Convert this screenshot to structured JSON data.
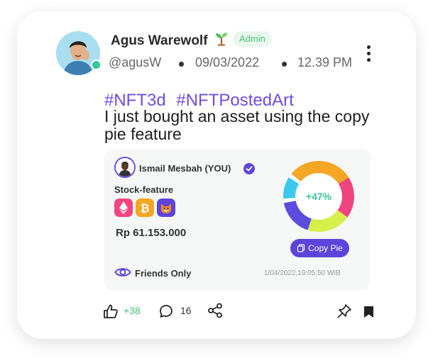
{
  "post": {
    "author": {
      "name": "Agus Warewolf",
      "role_badge": "Admin",
      "handle": "@agusW",
      "online": true
    },
    "date": "09/03/2022",
    "time": "12.39 PM",
    "hashtags": [
      "#NFT3d",
      "#NFTPostedArt"
    ],
    "text": "I just bought an asset using the copy pie feature",
    "shared_asset": {
      "owner_name": "Ismail Mesbah (YOU)",
      "section_label": "Stock-feature",
      "coins": [
        "ethereum-icon",
        "bitcoin-icon",
        "shiba-inu-icon"
      ],
      "price": "Rp 61.153.000",
      "visibility": "Friends Only",
      "timestamp": "1/04/2022,19:05:50 WIB",
      "pie_change": "+47%",
      "copy_button_label": "Copy Pie",
      "pie_segments": [
        {
          "color": "#f5a623",
          "fraction": 0.2
        },
        {
          "color": "#f0457f",
          "fraction": 0.19
        },
        {
          "color": "#d6ef4a",
          "fraction": 0.2
        },
        {
          "color": "#5b4de0",
          "fraction": 0.17
        },
        {
          "color": "#ffffff",
          "fraction": 0.02
        },
        {
          "color": "#3cc8ee",
          "fraction": 0.1
        },
        {
          "color": "#ffffff",
          "fraction": 0.02
        },
        {
          "color": "#f5a623",
          "fraction": 0.1
        }
      ]
    },
    "actions": {
      "likes": "+38",
      "comments": "16"
    }
  },
  "colors": {
    "accent": "#6e4de0",
    "button": "#5d44dc",
    "positive": "#47c27a"
  }
}
